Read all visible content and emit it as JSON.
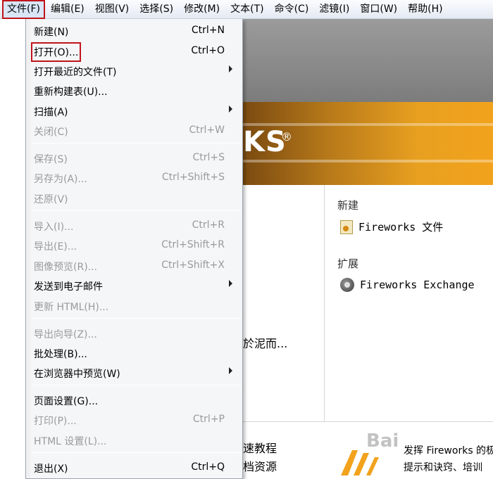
{
  "menubar": {
    "items": [
      {
        "label": "文件(F)",
        "active": true
      },
      {
        "label": "编辑(E)"
      },
      {
        "label": "视图(V)"
      },
      {
        "label": "选择(S)"
      },
      {
        "label": "修改(M)"
      },
      {
        "label": "文本(T)"
      },
      {
        "label": "命令(C)"
      },
      {
        "label": "滤镜(I)"
      },
      {
        "label": "窗口(W)"
      },
      {
        "label": "帮助(H)"
      }
    ]
  },
  "file_menu": {
    "items": [
      {
        "label": "新建(N)",
        "shortcut": "Ctrl+N"
      },
      {
        "label": "打开(O)...",
        "shortcut": "Ctrl+O",
        "highlighted": true
      },
      {
        "label": "打开最近的文件(T)",
        "submenu": true
      },
      {
        "label": "重新构建表(U)..."
      },
      {
        "label": "扫描(A)",
        "submenu": true
      },
      {
        "label": "关闭(C)",
        "shortcut": "Ctrl+W",
        "disabled": true
      },
      {
        "label": "保存(S)",
        "shortcut": "Ctrl+S",
        "disabled": true
      },
      {
        "label": "另存为(A)...",
        "shortcut": "Ctrl+Shift+S",
        "disabled": true
      },
      {
        "label": "还原(V)",
        "disabled": true
      },
      {
        "label": "导入(I)...",
        "shortcut": "Ctrl+R",
        "disabled": true
      },
      {
        "label": "导出(E)...",
        "shortcut": "Ctrl+Shift+R",
        "disabled": true
      },
      {
        "label": "图像预览(R)...",
        "shortcut": "Ctrl+Shift+X",
        "disabled": true
      },
      {
        "label": "发送到电子邮件",
        "submenu": true
      },
      {
        "label": "更新 HTML(H)...",
        "disabled": true
      },
      {
        "label": "导出向导(Z)...",
        "disabled": true
      },
      {
        "label": "批处理(B)..."
      },
      {
        "label": "在浏览器中预览(W)",
        "submenu": true
      },
      {
        "label": "页面设置(G)..."
      },
      {
        "label": "打印(P)...",
        "shortcut": "Ctrl+P",
        "disabled": true
      },
      {
        "label": "HTML 设置(L)...",
        "disabled": true
      },
      {
        "label": "退出(X)",
        "shortcut": "Ctrl+Q"
      }
    ]
  },
  "start_page": {
    "logo_text": "KS",
    "logo_reg": "®",
    "new_heading": "新建",
    "new_item": "Fireworks 文件",
    "extend_heading": "扩展",
    "extend_item": "Fireworks Exchange",
    "mid_text": "於泥而...",
    "bottom_left_1": "速教程",
    "bottom_left_2": "档资源",
    "bottom_right_1": "发挥 Fireworks 的极",
    "bottom_right_2": "提示和诀窍、培训"
  },
  "watermark": "Bai"
}
